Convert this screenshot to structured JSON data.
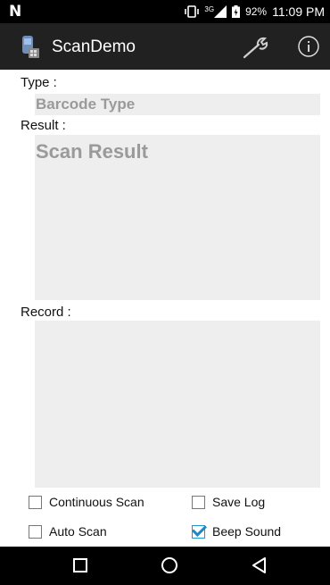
{
  "status_bar": {
    "signal_label": "3G",
    "battery_percent": "92%",
    "time": "11:09 PM"
  },
  "app_bar": {
    "title": "ScanDemo",
    "icons": [
      "scanner-app-icon",
      "wrench-icon",
      "info-icon"
    ]
  },
  "form": {
    "type_label": "Type :",
    "type_value": "Barcode Type",
    "result_label": "Result :",
    "result_value": "Scan Result",
    "record_label": "Record :",
    "record_value": ""
  },
  "options": {
    "continuous_scan": {
      "label": "Continuous Scan",
      "checked": false
    },
    "save_log": {
      "label": "Save Log",
      "checked": false
    },
    "auto_scan": {
      "label": "Auto Scan",
      "checked": false
    },
    "beep_sound": {
      "label": "Beep Sound",
      "checked": true
    }
  },
  "nav_bar": {
    "icons": [
      "recents-square-icon",
      "home-circle-icon",
      "back-triangle-icon"
    ]
  },
  "colors": {
    "status_bar": "#000000",
    "app_bar": "#212121",
    "field_bg": "#eeeeee",
    "field_text": "#9a9a9a",
    "check_accent": "#1e88c7"
  }
}
